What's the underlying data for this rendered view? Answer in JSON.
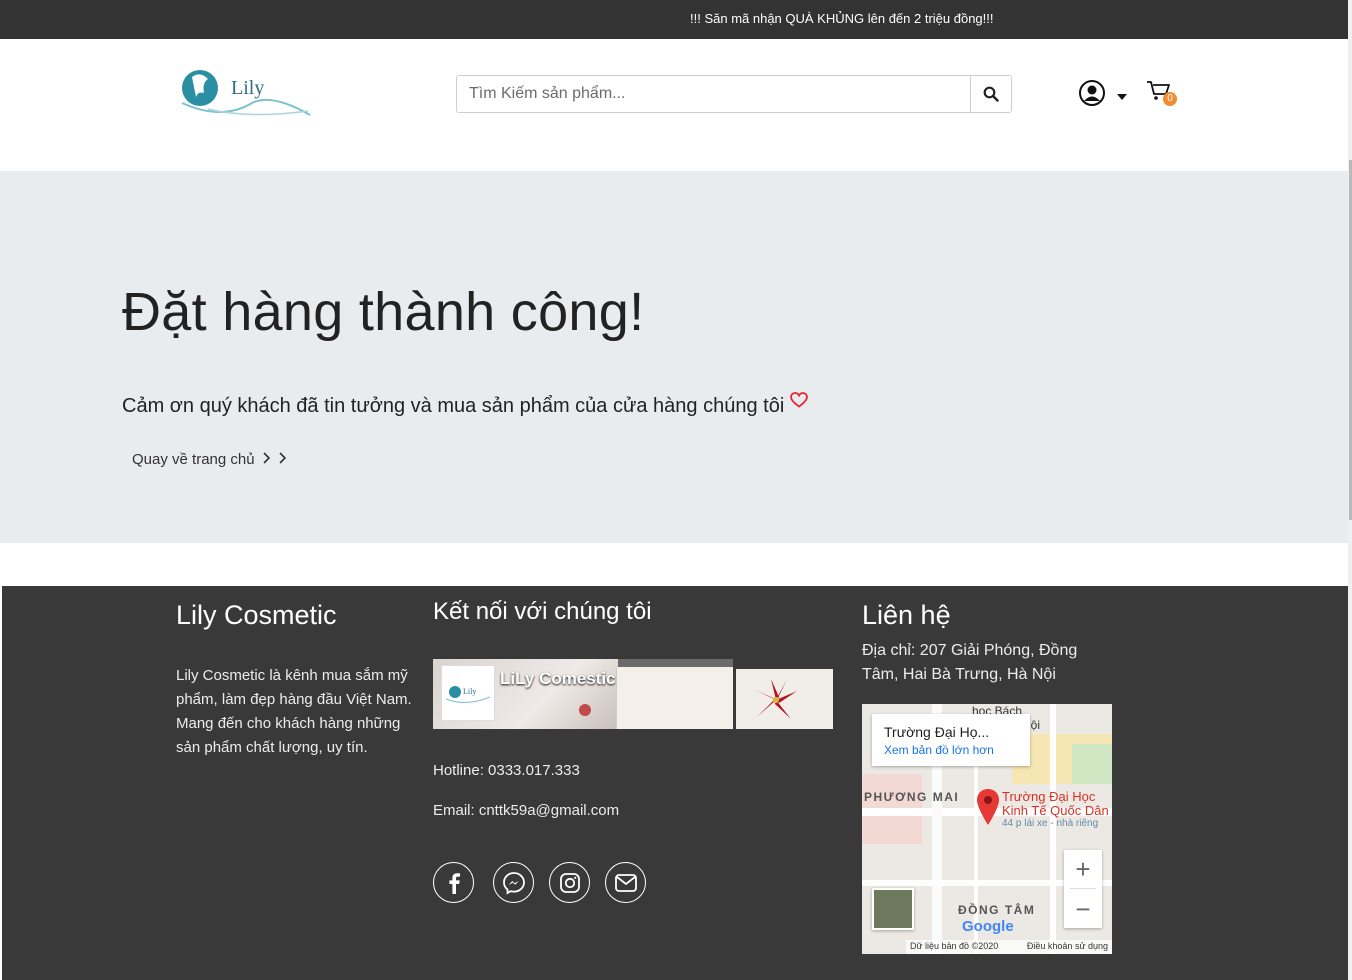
{
  "topbar": {
    "promo": "!!! Săn mã nhận QUÀ KHỦNG lên đến 2 triệu đồng!!!"
  },
  "header": {
    "logo_text": "Lily",
    "search": {
      "placeholder": "Tìm Kiếm sản phẩm...",
      "value": ""
    },
    "cart_count": "0",
    "icons": [
      "search-icon",
      "user-icon",
      "cart-icon"
    ]
  },
  "hero": {
    "title": "Đặt hàng thành công!",
    "message": "Cảm ơn quý khách đã tin tưởng và mua sản phẩm của cửa hàng chúng tôi",
    "home_link": "Quay về trang chủ"
  },
  "footer": {
    "about": {
      "title": "Lily Cosmetic",
      "description": "Lily Cosmetic là kênh mua sắm mỹ phẩm, làm đẹp hàng đầu Việt Nam. Mang đến cho khách hàng những sản phẩm chất lượng, uy tín."
    },
    "connect": {
      "title": "Kết nối với chúng tôi",
      "fb_page_name": "LiLy Comestic",
      "fb_avatar_text": "Lily",
      "hotline": "Hotline: 0333.017.333",
      "email": "Email: cnttk59a@gmail.com",
      "socials": [
        "facebook-icon",
        "messenger-icon",
        "instagram-icon",
        "mail-icon"
      ]
    },
    "contact": {
      "title": "Liên hệ",
      "address": "Địa chỉ: 207 Giải Phóng, Đồng Tâm, Hai Bà Trưng, Hà Nội",
      "map": {
        "card_title": "Trường Đại Họ...",
        "card_link": "Xem bản đồ lớn hơn",
        "pin_label": "Trường Đại Học Kinh Tế Quốc Dân",
        "pin_sub": "44 p lái xe - nhà riêng",
        "area1": "PHƯƠNG MAI",
        "area2": "ĐỒNG TÂM",
        "area3": "học Bách",
        "area4": "lội",
        "logo": "Google",
        "attribution": "Dữ liệu bản đồ ©2020",
        "terms": "Điều khoản sử dụng"
      }
    }
  },
  "colors": {
    "topbar_bg": "#333333",
    "hero_bg": "#e9ecef",
    "footer_bg": "#393939",
    "badge": "#f08d2e",
    "heart": "#e8242e"
  }
}
